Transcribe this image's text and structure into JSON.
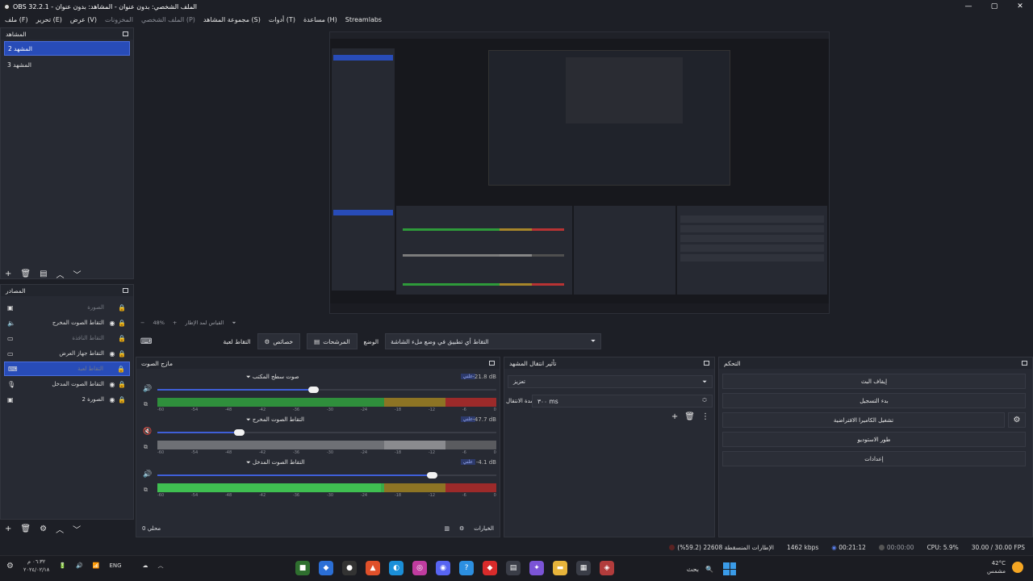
{
  "window": {
    "title": "OBS 32.2.1 - الملف الشخصي: بدون عنوان - المشاهد: بدون عنوان",
    "controls": [
      "—",
      "▢",
      "✕"
    ]
  },
  "menu": [
    "ملف (F)",
    "تحرير (E)",
    "عرض (V)",
    "المخزونات",
    "الملف الشخصي (P)",
    "مجموعة المشاهد (S)",
    "أدوات (T)",
    "مساعدة (H)",
    "Streamlabs"
  ],
  "scenes": {
    "title": "المشاهد",
    "items": [
      "المشهد 2",
      "المشهد 3"
    ],
    "active": 0
  },
  "sources": {
    "title": "المصادر",
    "items": [
      {
        "name": "الصورة",
        "type_icon": "image-icon",
        "glyph": "▣",
        "hidden": true
      },
      {
        "name": "التقاط الصوت المخرج",
        "type_icon": "speaker-icon",
        "glyph": "🔈",
        "hidden": false
      },
      {
        "name": "التقاط النافذة",
        "type_icon": "window-icon",
        "glyph": "▭",
        "hidden": true
      },
      {
        "name": "التقاط جهاز العرض",
        "type_icon": "monitor-icon",
        "glyph": "▭",
        "hidden": false
      },
      {
        "name": "التقاط لعبة",
        "type_icon": "gamepad-icon",
        "glyph": "⌨",
        "hidden": true,
        "active": true
      },
      {
        "name": "التقاط الصوت المدخل",
        "type_icon": "microphone-icon",
        "glyph": "🎙",
        "hidden": false
      },
      {
        "name": "الصورة 2",
        "type_icon": "image-icon",
        "glyph": "▣",
        "hidden": false
      }
    ]
  },
  "preview": {
    "zoom": "48%",
    "scale_label": "القياس لمد الإطار"
  },
  "context_bar": {
    "source_label": "التقاط لعبة",
    "properties_label": "خصائص",
    "filters_label": "المرشحات",
    "mode_label": "الوضع",
    "mode_value": "التقاط أي تطبيق في وضع ملء الشاشة"
  },
  "mixer": {
    "title": "مازج الصوت",
    "channels": [
      {
        "name": "صوت سطح المكتب",
        "db": "-21.8 dB",
        "badge": "علني",
        "volume": 0.46,
        "level": 0.0,
        "muted": false,
        "style": "color"
      },
      {
        "name": "التقاط الصوت المخرج",
        "db": "-47.7 dB",
        "badge": "علني",
        "volume": 0.24,
        "level": 0.0,
        "muted": true,
        "style": "gray"
      },
      {
        "name": "التقاط الصوت المدخل",
        "db": "-4.1 dB",
        "badge": "علني",
        "volume": 0.81,
        "level": 0.66,
        "muted": false,
        "style": "bright"
      }
    ],
    "ticks": [
      "-60",
      "-54",
      "-48",
      "-42",
      "-36",
      "-30",
      "-24",
      "-18",
      "-12",
      "-6",
      "0"
    ],
    "footer_left": "محلي 0",
    "footer_right": "الخيارات"
  },
  "transitions": {
    "title": "تأثير انتقال المشهد",
    "selected": "تعزيز",
    "duration_label": "مدة الانتقال",
    "duration_value": "٣٠٠ ms"
  },
  "controls": {
    "title": "التحكم",
    "buttons": [
      "إيقاف البث",
      "بدء التسجيل",
      "تشغيل الكاميرا الافتراضية",
      "طور الاستوديو",
      "إعدادات"
    ]
  },
  "status": {
    "dropped": "الإطارات المنسقطة 22608 (59.2%)",
    "bitrate": "1462 kbps",
    "stream_time": "00:21:12",
    "record_time": "00:00:00",
    "cpu": "CPU: 5.9%",
    "fps": "30.00 / 30.00 FPS"
  },
  "taskbar": {
    "time": "٠٦:٣٢ م",
    "date": "٢٠٢٤/٠٢/١٨",
    "lang": "ENG",
    "search_label": "بحث",
    "temp": "42°C",
    "weather": "مشمس",
    "apps": [
      {
        "icon": "minecraft-icon",
        "color": "#2f6f2f",
        "glyph": "■"
      },
      {
        "icon": "blue-app-icon",
        "color": "#2b6fd6",
        "glyph": "◆"
      },
      {
        "icon": "obs-icon",
        "color": "#333333",
        "glyph": "●"
      },
      {
        "icon": "brave-icon",
        "color": "#e0502a",
        "glyph": "▲"
      },
      {
        "icon": "edge-icon",
        "color": "#1b8fd8",
        "glyph": "◐"
      },
      {
        "icon": "instagram-icon",
        "color": "#c03ca0",
        "glyph": "◎"
      },
      {
        "icon": "discord-icon",
        "color": "#5865f2",
        "glyph": "◉"
      },
      {
        "icon": "help-icon",
        "color": "#2c8fe0",
        "glyph": "?"
      },
      {
        "icon": "red-app-icon",
        "color": "#d92b2b",
        "glyph": "◆"
      },
      {
        "icon": "store-icon",
        "color": "#3a3d47",
        "glyph": "▤"
      },
      {
        "icon": "copilot-icon",
        "color": "#7b54d6",
        "glyph": "✦"
      },
      {
        "icon": "folder-icon",
        "color": "#e7b43b",
        "glyph": "▬"
      },
      {
        "icon": "stack-icon",
        "color": "#3a3d47",
        "glyph": "▦"
      },
      {
        "icon": "game-icon",
        "color": "#b23c3c",
        "glyph": "◈"
      }
    ]
  }
}
